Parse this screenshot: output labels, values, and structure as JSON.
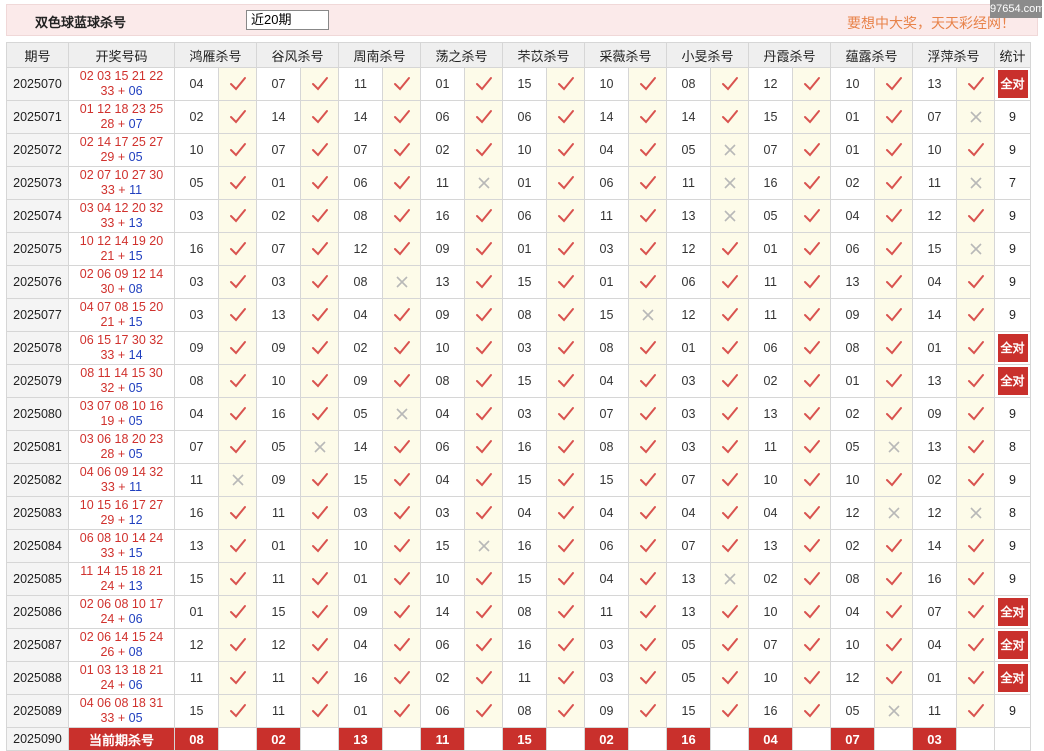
{
  "header": {
    "title": "双色球蓝球杀号",
    "period_select": "近20期",
    "slogan": "要想中大奖，天天彩经网！",
    "watermark": "97654.com"
  },
  "columns": {
    "issue": "期号",
    "draw": "开奖号码",
    "experts": [
      "鸿雁杀号",
      "谷风杀号",
      "周南杀号",
      "荡之杀号",
      "芣苡杀号",
      "采薇杀号",
      "小旻杀号",
      "丹霞杀号",
      "蕴露杀号",
      "浮萍杀号"
    ],
    "stat": "统计"
  },
  "all_correct_label": "全对",
  "current_label": "当前期杀号",
  "rows": [
    {
      "issue": "2025070",
      "red1": "02 03 15 21 22",
      "red2": "33",
      "blue": "06",
      "kills": [
        "04",
        "07",
        "11",
        "01",
        "15",
        "10",
        "08",
        "12",
        "10",
        "13"
      ],
      "hits": [
        1,
        1,
        1,
        1,
        1,
        1,
        1,
        1,
        1,
        1
      ],
      "stat": "全对"
    },
    {
      "issue": "2025071",
      "red1": "01 12 18 23 25",
      "red2": "28",
      "blue": "07",
      "kills": [
        "02",
        "14",
        "14",
        "06",
        "06",
        "14",
        "14",
        "15",
        "01",
        "07"
      ],
      "hits": [
        1,
        1,
        1,
        1,
        1,
        1,
        1,
        1,
        1,
        0
      ],
      "stat": "9"
    },
    {
      "issue": "2025072",
      "red1": "02 14 17 25 27",
      "red2": "29",
      "blue": "05",
      "kills": [
        "10",
        "07",
        "07",
        "02",
        "10",
        "04",
        "05",
        "07",
        "01",
        "10"
      ],
      "hits": [
        1,
        1,
        1,
        1,
        1,
        1,
        0,
        1,
        1,
        1
      ],
      "stat": "9"
    },
    {
      "issue": "2025073",
      "red1": "02 07 10 27 30",
      "red2": "33",
      "blue": "11",
      "kills": [
        "05",
        "01",
        "06",
        "11",
        "01",
        "06",
        "11",
        "16",
        "02",
        "11"
      ],
      "hits": [
        1,
        1,
        1,
        0,
        1,
        1,
        0,
        1,
        1,
        0
      ],
      "stat": "7"
    },
    {
      "issue": "2025074",
      "red1": "03 04 12 20 32",
      "red2": "33",
      "blue": "13",
      "kills": [
        "03",
        "02",
        "08",
        "16",
        "06",
        "11",
        "13",
        "05",
        "04",
        "12"
      ],
      "hits": [
        1,
        1,
        1,
        1,
        1,
        1,
        0,
        1,
        1,
        1
      ],
      "stat": "9"
    },
    {
      "issue": "2025075",
      "red1": "10 12 14 19 20",
      "red2": "21",
      "blue": "15",
      "kills": [
        "16",
        "07",
        "12",
        "09",
        "01",
        "03",
        "12",
        "01",
        "06",
        "15"
      ],
      "hits": [
        1,
        1,
        1,
        1,
        1,
        1,
        1,
        1,
        1,
        0
      ],
      "stat": "9"
    },
    {
      "issue": "2025076",
      "red1": "02 06 09 12 14",
      "red2": "30",
      "blue": "08",
      "kills": [
        "03",
        "03",
        "08",
        "13",
        "15",
        "01",
        "06",
        "11",
        "13",
        "04"
      ],
      "hits": [
        1,
        1,
        0,
        1,
        1,
        1,
        1,
        1,
        1,
        1
      ],
      "stat": "9"
    },
    {
      "issue": "2025077",
      "red1": "04 07 08 15 20",
      "red2": "21",
      "blue": "15",
      "kills": [
        "03",
        "13",
        "04",
        "09",
        "08",
        "15",
        "12",
        "11",
        "09",
        "14"
      ],
      "hits": [
        1,
        1,
        1,
        1,
        1,
        0,
        1,
        1,
        1,
        1
      ],
      "stat": "9"
    },
    {
      "issue": "2025078",
      "red1": "06 15 17 30 32",
      "red2": "33",
      "blue": "14",
      "kills": [
        "09",
        "09",
        "02",
        "10",
        "03",
        "08",
        "01",
        "06",
        "08",
        "01"
      ],
      "hits": [
        1,
        1,
        1,
        1,
        1,
        1,
        1,
        1,
        1,
        1
      ],
      "stat": "全对"
    },
    {
      "issue": "2025079",
      "red1": "08 11 14 15 30",
      "red2": "32",
      "blue": "05",
      "kills": [
        "08",
        "10",
        "09",
        "08",
        "15",
        "04",
        "03",
        "02",
        "01",
        "13"
      ],
      "hits": [
        1,
        1,
        1,
        1,
        1,
        1,
        1,
        1,
        1,
        1
      ],
      "stat": "全对"
    },
    {
      "issue": "2025080",
      "red1": "03 07 08 10 16",
      "red2": "19",
      "blue": "05",
      "kills": [
        "04",
        "16",
        "05",
        "04",
        "03",
        "07",
        "03",
        "13",
        "02",
        "09"
      ],
      "hits": [
        1,
        1,
        0,
        1,
        1,
        1,
        1,
        1,
        1,
        1
      ],
      "stat": "9"
    },
    {
      "issue": "2025081",
      "red1": "03 06 18 20 23",
      "red2": "28",
      "blue": "05",
      "kills": [
        "07",
        "05",
        "14",
        "06",
        "16",
        "08",
        "03",
        "11",
        "05",
        "13"
      ],
      "hits": [
        1,
        0,
        1,
        1,
        1,
        1,
        1,
        1,
        0,
        1
      ],
      "stat": "8"
    },
    {
      "issue": "2025082",
      "red1": "04 06 09 14 32",
      "red2": "33",
      "blue": "11",
      "kills": [
        "11",
        "09",
        "15",
        "04",
        "15",
        "15",
        "07",
        "10",
        "10",
        "02"
      ],
      "hits": [
        0,
        1,
        1,
        1,
        1,
        1,
        1,
        1,
        1,
        1
      ],
      "stat": "9"
    },
    {
      "issue": "2025083",
      "red1": "10 15 16 17 27",
      "red2": "29",
      "blue": "12",
      "kills": [
        "16",
        "11",
        "03",
        "03",
        "04",
        "04",
        "04",
        "04",
        "12",
        "12"
      ],
      "hits": [
        1,
        1,
        1,
        1,
        1,
        1,
        1,
        1,
        0,
        0
      ],
      "stat": "8"
    },
    {
      "issue": "2025084",
      "red1": "06 08 10 14 24",
      "red2": "33",
      "blue": "15",
      "kills": [
        "13",
        "01",
        "10",
        "15",
        "16",
        "06",
        "07",
        "13",
        "02",
        "14"
      ],
      "hits": [
        1,
        1,
        1,
        0,
        1,
        1,
        1,
        1,
        1,
        1
      ],
      "stat": "9"
    },
    {
      "issue": "2025085",
      "red1": "11 14 15 18 21",
      "red2": "24",
      "blue": "13",
      "kills": [
        "15",
        "11",
        "01",
        "10",
        "15",
        "04",
        "13",
        "02",
        "08",
        "16"
      ],
      "hits": [
        1,
        1,
        1,
        1,
        1,
        1,
        0,
        1,
        1,
        1
      ],
      "stat": "9"
    },
    {
      "issue": "2025086",
      "red1": "02 06 08 10 17",
      "red2": "24",
      "blue": "06",
      "kills": [
        "01",
        "15",
        "09",
        "14",
        "08",
        "11",
        "13",
        "10",
        "04",
        "07"
      ],
      "hits": [
        1,
        1,
        1,
        1,
        1,
        1,
        1,
        1,
        1,
        1
      ],
      "stat": "全对"
    },
    {
      "issue": "2025087",
      "red1": "02 06 14 15 24",
      "red2": "26",
      "blue": "08",
      "kills": [
        "12",
        "12",
        "04",
        "06",
        "16",
        "03",
        "05",
        "07",
        "10",
        "04"
      ],
      "hits": [
        1,
        1,
        1,
        1,
        1,
        1,
        1,
        1,
        1,
        1
      ],
      "stat": "全对"
    },
    {
      "issue": "2025088",
      "red1": "01 03 13 18 21",
      "red2": "24",
      "blue": "06",
      "kills": [
        "11",
        "11",
        "16",
        "02",
        "11",
        "03",
        "05",
        "10",
        "12",
        "01"
      ],
      "hits": [
        1,
        1,
        1,
        1,
        1,
        1,
        1,
        1,
        1,
        1
      ],
      "stat": "全对"
    },
    {
      "issue": "2025089",
      "red1": "04 06 08 18 31",
      "red2": "33",
      "blue": "05",
      "kills": [
        "15",
        "11",
        "01",
        "06",
        "08",
        "09",
        "15",
        "16",
        "05",
        "11"
      ],
      "hits": [
        1,
        1,
        1,
        1,
        1,
        1,
        1,
        1,
        0,
        1
      ],
      "stat": "9"
    }
  ],
  "current": {
    "issue": "2025090",
    "kills": [
      "08",
      "02",
      "13",
      "11",
      "15",
      "02",
      "16",
      "04",
      "07",
      "03"
    ]
  },
  "colors": {
    "check": "#d9534f",
    "cross": "#b8b8b8",
    "badge": "#c9302c",
    "blue_ball": "#1f3fbf",
    "red_ball": "#d0312d"
  }
}
